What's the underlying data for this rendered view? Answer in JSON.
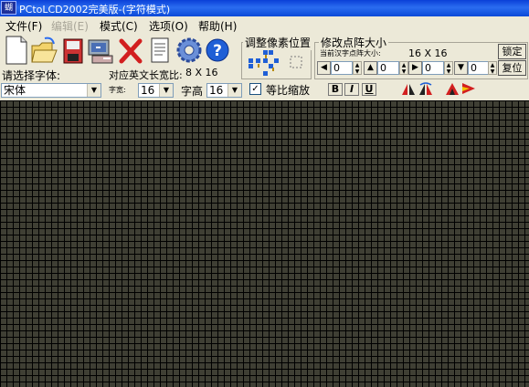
{
  "window": {
    "title": "PCtoLCD2002完美版-(字符模式)",
    "icon_text": "蝴"
  },
  "menu": [
    {
      "label": "文件(F)",
      "enabled": true
    },
    {
      "label": "编辑(E)",
      "enabled": false
    },
    {
      "label": "模式(C)",
      "enabled": true
    },
    {
      "label": "选项(O)",
      "enabled": true
    },
    {
      "label": "帮助(H)",
      "enabled": true
    }
  ],
  "toolbar": {
    "icons": [
      "new-file-icon",
      "open-folder-icon",
      "save-disk-icon",
      "generate-code-icon",
      "delete-x-icon",
      "document-icon",
      "settings-gear-icon",
      "help-question-icon"
    ]
  },
  "font": {
    "select_label": "请选择字体:",
    "font_name": "宋体",
    "width_label": "字宽:",
    "width_value": "16",
    "height_label": "字高",
    "height_value": "16",
    "proportional_label": "等比缩放",
    "proportional_checked": true
  },
  "ratio": {
    "label": "对应英文长宽比:",
    "value": "8 X 16"
  },
  "pixel_position": {
    "title": "调整像素位置"
  },
  "dot_size": {
    "title": "修改点阵大小",
    "current_label": "当前汉字点阵大小:",
    "current_value": "16 X 16",
    "lock_label": "锁定",
    "reset_label": "复位",
    "spin_values": [
      "0",
      "0",
      "0",
      "0"
    ]
  },
  "format": {
    "bold": "B",
    "italic": "I",
    "underline": "U"
  }
}
